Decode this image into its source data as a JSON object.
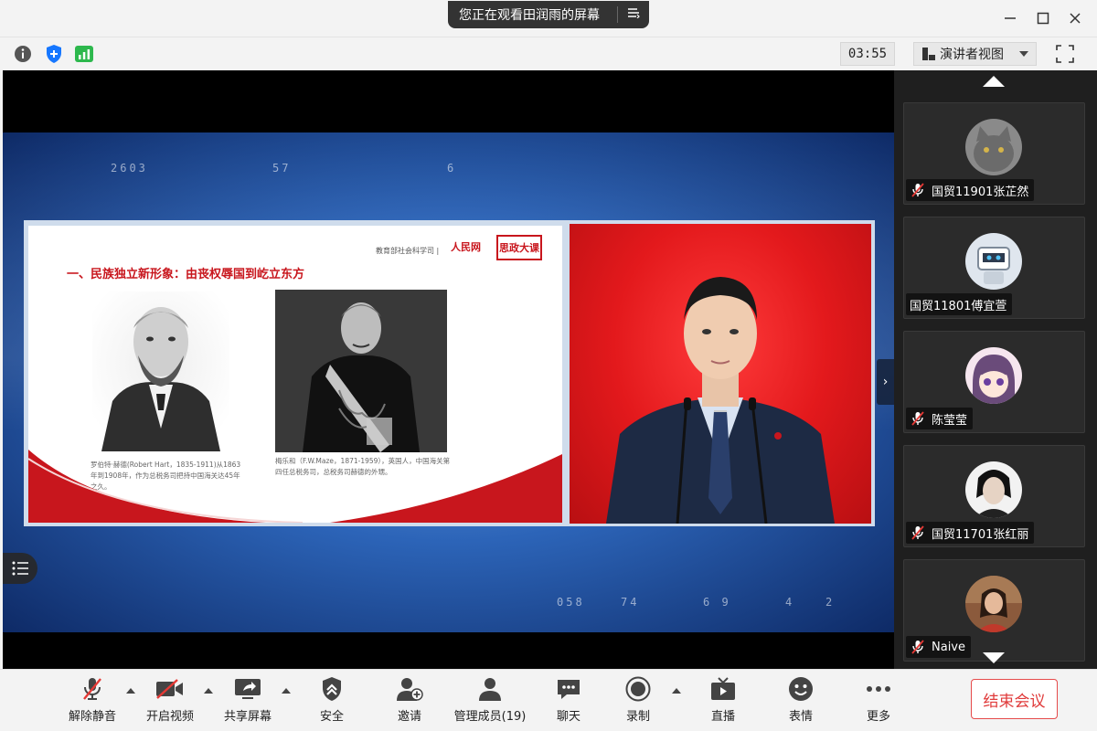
{
  "title_bar": {
    "share_status": "您正在观看田润雨的屏幕",
    "controls": {
      "menu_icon": "list-menu-icon",
      "minimize_icon": "minimize-icon",
      "maximize_icon": "maximize-icon",
      "close_icon": "close-icon"
    }
  },
  "info_bar": {
    "icons": [
      "info-icon",
      "shield-icon",
      "signal-icon"
    ],
    "timer": "03:55",
    "view_mode": "演讲者视图",
    "fullscreen_icon": "fullscreen-icon"
  },
  "shared_screen": {
    "bg_digits": [
      "2603",
      "57",
      "6",
      "058",
      "74",
      "6 9",
      "4",
      "2"
    ],
    "slide": {
      "title": "一、民族独立新形象：由丧权辱国到屹立东方",
      "org": "教育部社会科学司  |",
      "logo": "人民网",
      "badge": "思政大课",
      "caption_left": "罗伯特·赫德(Robert Hart，1835-1911)从1863年到1908年，作为总税务司把持中国海关达45年之久。",
      "caption_right": "梅乐和（F.W.Maze，1871-1959），英国人，中国海关第四任总税务司，总税务司赫德的外甥。"
    }
  },
  "participants": [
    {
      "name": "国贸11901张芷然",
      "muted": true,
      "avatar": "cat-avatar"
    },
    {
      "name": "国贸11801傅宜萱",
      "muted": false,
      "avatar": "robot-avatar"
    },
    {
      "name": "陈莹莹",
      "muted": true,
      "avatar": "anime-avatar"
    },
    {
      "name": "国贸11701张红丽",
      "muted": true,
      "avatar": "portrait-avatar"
    },
    {
      "name": "Naive",
      "muted": true,
      "avatar": "photo-avatar"
    }
  ],
  "toolbar": {
    "unmute": "解除静音",
    "start_video": "开启视频",
    "share_screen": "共享屏幕",
    "security": "安全",
    "invite": "邀请",
    "manage_members": "管理成员(19)",
    "chat": "聊天",
    "record": "录制",
    "live": "直播",
    "reactions": "表情",
    "more": "更多",
    "end_meeting": "结束会议"
  },
  "colors": {
    "accent_red": "#e03a3a",
    "signal_green": "#2db84d",
    "shield_blue": "#1677ff",
    "slide_red": "#c8161d"
  }
}
